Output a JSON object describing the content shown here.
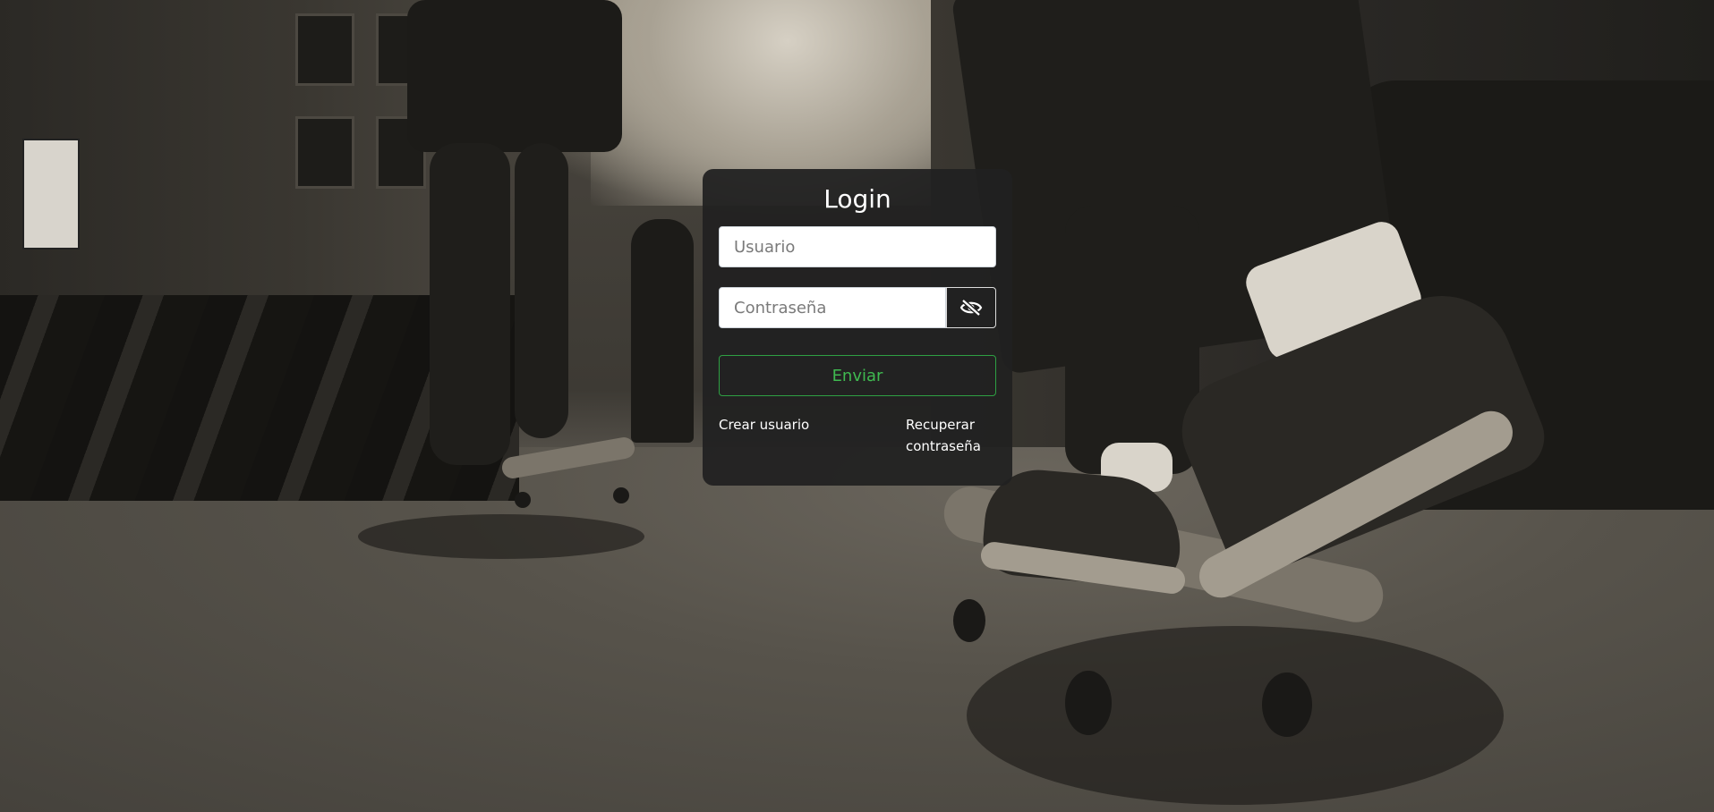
{
  "login": {
    "title": "Login",
    "username_placeholder": "Usuario",
    "password_placeholder": "Contraseña",
    "submit_label": "Enviar",
    "create_user_link": "Crear usuario",
    "recover_password_link": "Recuperar contraseña"
  },
  "icons": {
    "password_toggle": "eye-slash-icon"
  },
  "colors": {
    "card_background": "#212121",
    "accent_green": "#3fb950",
    "text": "#ffffff"
  }
}
